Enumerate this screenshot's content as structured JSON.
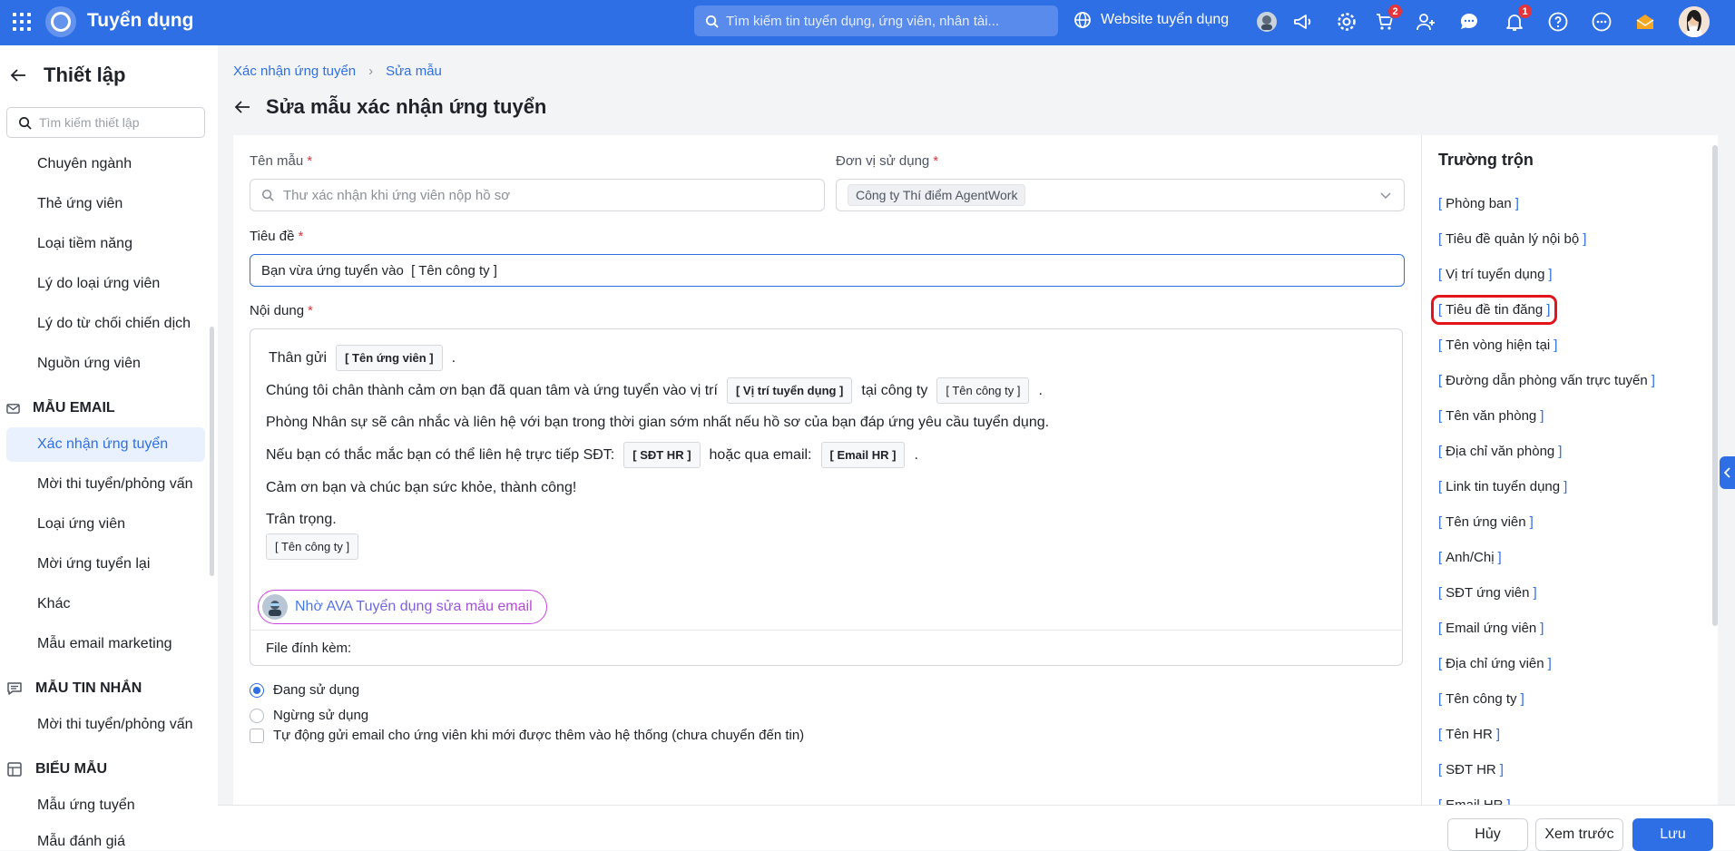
{
  "topbar": {
    "app_title": "Tuyển dụng",
    "search_placeholder": "Tìm kiếm tin tuyển dụng, ứng viên, nhân tài...",
    "website_link": "Website tuyển dụng",
    "cart_badge": "2",
    "notification_badge": "1"
  },
  "sidebar": {
    "title": "Thiết lập",
    "search_placeholder": "Tìm kiếm thiết lập",
    "items": [
      {
        "label": "Chuyên ngành"
      },
      {
        "label": "Thẻ ứng viên"
      },
      {
        "label": "Loại tiềm năng"
      },
      {
        "label": "Lý do loại ứng viên"
      },
      {
        "label": "Lý do từ chối chiến dịch"
      },
      {
        "label": "Nguồn ứng viên"
      }
    ],
    "section_email": "MẪU EMAIL",
    "email_items": [
      {
        "label": "Xác nhận ứng tuyển"
      },
      {
        "label": "Mời thi tuyển/phỏng vấn"
      },
      {
        "label": "Loại ứng viên"
      },
      {
        "label": "Mời ứng tuyển lại"
      },
      {
        "label": "Khác"
      },
      {
        "label": "Mẫu email marketing"
      }
    ],
    "section_sms": "MẪU TIN NHẮN",
    "sms_items": [
      {
        "label": "Mời thi tuyển/phỏng vấn"
      }
    ],
    "section_form": "BIỂU MẪU",
    "form_items": [
      {
        "label": "Mẫu ứng tuyển"
      },
      {
        "label": "Mẫu đánh giá"
      }
    ]
  },
  "breadcrumb": {
    "parent": "Xác nhận ứng tuyển",
    "current": "Sửa mẫu"
  },
  "page_title": "Sửa mẫu xác nhận ứng tuyển",
  "form": {
    "template_name_label": "Tên mẫu",
    "template_name_placeholder": "Thư xác nhận khi ứng viên nộp hồ sơ",
    "unit_label": "Đơn vị sử dụng",
    "unit_value": "Công ty Thí điểm AgentWork",
    "subject_label": "Tiêu đề",
    "subject_value": "Bạn vừa ứng tuyển vào  [ Tên công ty ]",
    "content_label": "Nội dung",
    "content": {
      "greeting": "Thân gửi",
      "tag_candidate": "[ Tên ứng viên ]",
      "line2_a": "Chúng tôi chân thành cảm ơn bạn đã quan tâm và ứng tuyển vào vị trí",
      "tag_position": "[ Vị trí tuyển dụng ]",
      "line2_b": "tại công ty",
      "tag_company": "[ Tên công ty ]",
      "line3": "Phòng Nhân sự sẽ cân nhắc và liên hệ với bạn trong thời gian sớm nhất nếu hồ sơ của bạn đáp ứng yêu cầu tuyển dụng.",
      "line4_a": "Nếu bạn có thắc mắc bạn có thể liên hệ trực tiếp SĐT:",
      "tag_hr_phone": "[ SĐT HR ]",
      "line4_b": "hoặc qua email:",
      "tag_hr_email": "[ Email HR ]",
      "line5": "Cảm ơn bạn và chúc bạn sức khỏe, thành công!",
      "line6": "Trân trọng.",
      "tag_company_sign": "[ Tên công ty ]",
      "dot": "."
    },
    "ava_button": "Nhờ AVA Tuyển dụng sửa mẫu email",
    "attachment_label": "File đính kèm:",
    "status_active": "Đang sử dụng",
    "status_inactive": "Ngừng sử dụng",
    "auto_send": "Tự động gửi email cho ứng viên khi mới được thêm vào hệ thống (chưa chuyển đến tin)"
  },
  "merge_fields": {
    "title": "Trường trộn",
    "items": [
      "Phòng ban",
      "Tiêu đề quản lý nội bộ",
      "Vị trí tuyển dụng",
      "Tiêu đề tin đăng",
      "Tên vòng hiện tại",
      "Đường dẫn phòng vấn trực tuyến",
      "Tên văn phòng",
      "Địa chỉ văn phòng",
      "Link tin tuyển dụng",
      "Tên ứng viên",
      "Anh/Chị",
      "SĐT ứng viên",
      "Email ứng viên",
      "Địa chỉ ứng viên",
      "Tên công ty",
      "Tên HR",
      "SĐT HR",
      "Email HR"
    ],
    "open_bracket": "[",
    "close_bracket": "]"
  },
  "footer": {
    "cancel": "Hủy",
    "preview": "Xem trước",
    "save": "Lưu"
  },
  "colors": {
    "brand": "#2f6fe6",
    "highlight": "#e4141b"
  }
}
